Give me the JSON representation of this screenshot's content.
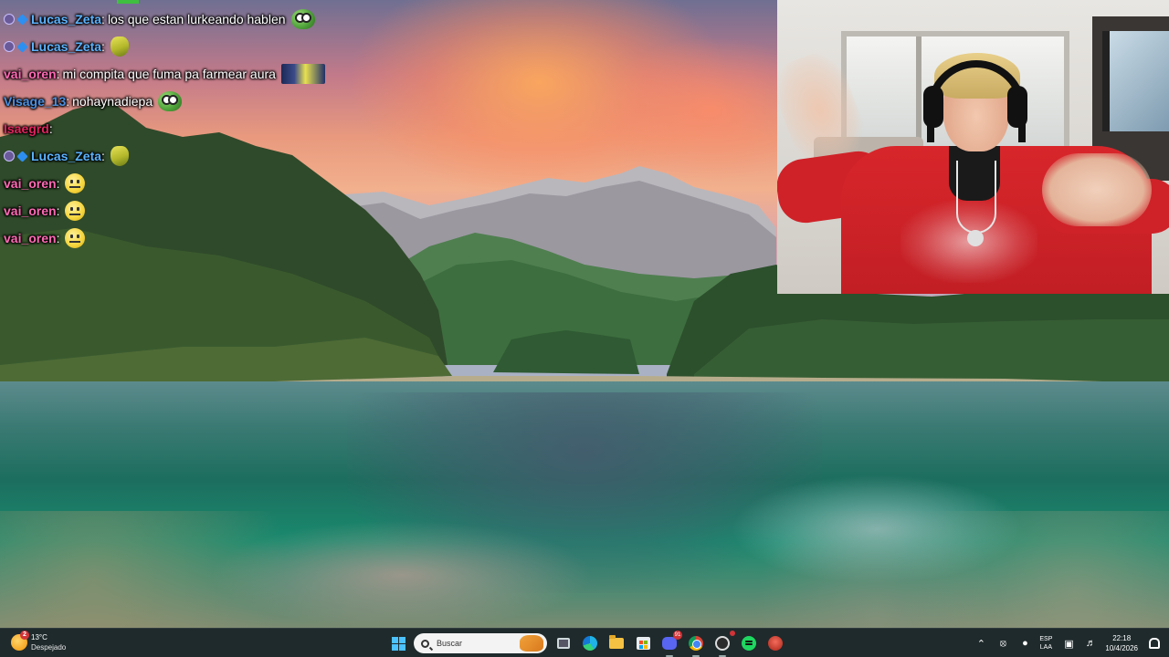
{
  "chat": {
    "messages": [
      {
        "user": "Lucas_Zeta",
        "user_color": "#5bb3ff",
        "text": "los que estan lurkeando hablen",
        "badges": true,
        "emote": "frog-emote"
      },
      {
        "user": "Lucas_Zeta",
        "user_color": "#5bb3ff",
        "text": "",
        "badges": true,
        "emote": "pickle-emote"
      },
      {
        "user": "vai_oren",
        "user_color": "#ff69b4",
        "text": "mi compita que fuma pa farmear aura",
        "badges": false,
        "emote": "banner-emote"
      },
      {
        "user": "Visage_13",
        "user_color": "#4a90e2",
        "text": "nohaynadiepa",
        "badges": false,
        "emote": "frog-emote"
      },
      {
        "user": "Isaegrd",
        "user_color": "#e0245e",
        "text": "",
        "badges": false,
        "emote": ""
      },
      {
        "user": "Lucas_Zeta",
        "user_color": "#5bb3ff",
        "text": "",
        "badges": true,
        "emote": "pickle-emote"
      },
      {
        "user": "vai_oren",
        "user_color": "#ff69b4",
        "text": "",
        "badges": false,
        "emote": "smile-emote"
      },
      {
        "user": "vai_oren",
        "user_color": "#ff69b4",
        "text": "",
        "badges": false,
        "emote": "smile-emote"
      },
      {
        "user": "vai_oren",
        "user_color": "#ff69b4",
        "text": "",
        "badges": false,
        "emote": "smile-emote"
      }
    ]
  },
  "taskbar": {
    "weather": {
      "temp": "13°C",
      "desc": "Despejado",
      "badge": "2"
    },
    "search_placeholder": "Buscar",
    "discord_badge": "91",
    "tray": {
      "lang_top": "ESP",
      "lang_bottom": "LAA",
      "time": "22:18",
      "date": "10/4/2026"
    }
  },
  "colors": {
    "taskbar_bg": "#1f2a2c",
    "accent": "#4cc2ff"
  }
}
